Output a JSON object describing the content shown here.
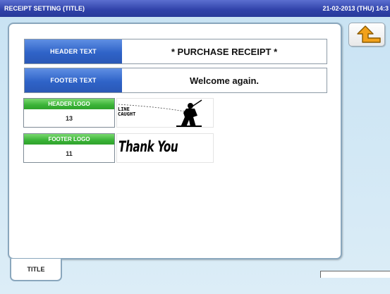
{
  "titlebar": {
    "title": "RECEIPT SETTING (TITLE)",
    "datetime": "21-02-2013 (THU) 14:3"
  },
  "rows": [
    {
      "label": "HEADER TEXT",
      "value": "* PURCHASE RECEIPT *"
    },
    {
      "label": "FOOTER TEXT",
      "value": "Welcome again."
    }
  ],
  "logos": [
    {
      "label": "HEADER LOGO",
      "number": "13",
      "image_text": "LINE CAUGHT"
    },
    {
      "label": "FOOTER LOGO",
      "number": "11",
      "image_text": "Thank You"
    }
  ],
  "tabs": [
    {
      "label": "TITLE",
      "active": true
    }
  ],
  "colors": {
    "titlebar": "#2f41a8",
    "field_label": "#2f63c8",
    "logo_label": "#3ab337",
    "background": "#cfe6f4",
    "back_arrow": "#f2a11a"
  },
  "icons": {
    "back": "return-arrow-icon"
  }
}
